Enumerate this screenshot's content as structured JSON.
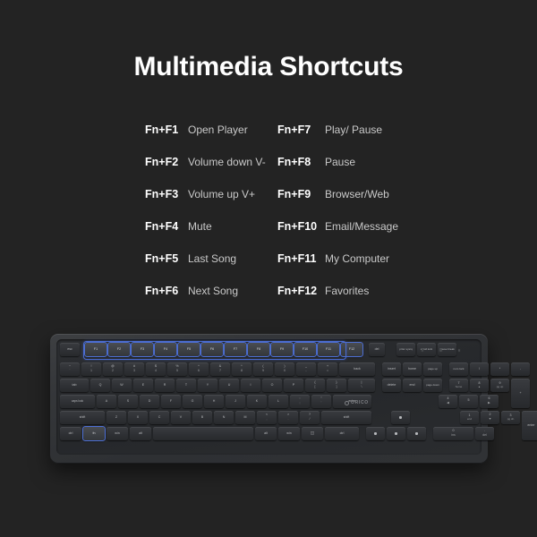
{
  "page": {
    "background_color": "#232323",
    "title": "Multimedia Shortcuts"
  },
  "shortcuts": {
    "rows": [
      {
        "left_combo": "Fn+F1",
        "left_action": "Open Player",
        "right_combo": "Fn+F7",
        "right_action": "Play/ Pause"
      },
      {
        "left_combo": "Fn+F2",
        "left_action": "Volume down V-",
        "right_combo": "Fn+F8",
        "right_action": "Pause"
      },
      {
        "left_combo": "Fn+F3",
        "left_action": "Volume up V+",
        "right_combo": "Fn+F9",
        "right_action": "Browser/Web"
      },
      {
        "left_combo": "Fn+F4",
        "left_action": "Mute",
        "right_combo": "Fn+F10",
        "right_action": "Email/Message"
      },
      {
        "left_combo": "Fn+F5",
        "left_action": "Last Song",
        "right_combo": "Fn+F11",
        "right_action": "My Computer"
      },
      {
        "left_combo": "Fn+F6",
        "left_action": "Next Song",
        "right_combo": "Fn+F12",
        "right_action": "Favorites"
      }
    ]
  },
  "keyboard": {
    "brand": "ORICO",
    "highlight_color": "#4a6bd0",
    "highlighted_keys": [
      "F1",
      "F2",
      "F3",
      "F4",
      "F5",
      "F6",
      "F7",
      "F8",
      "F9",
      "F10",
      "F11",
      "F12",
      "fn"
    ],
    "indicator_leds": 3,
    "rows": {
      "function_row": [
        {
          "label": "esc"
        },
        {
          "label": "F1"
        },
        {
          "label": "F2"
        },
        {
          "label": "F3"
        },
        {
          "label": "F4"
        },
        {
          "label": "F5"
        },
        {
          "label": "F6"
        },
        {
          "label": "F7"
        },
        {
          "label": "F8"
        },
        {
          "label": "F9"
        },
        {
          "label": "F10"
        },
        {
          "label": "F11"
        },
        {
          "label": "F12"
        },
        {
          "label": "del"
        },
        {
          "label": "prtsc sysrq"
        },
        {
          "label": "scroll lock"
        },
        {
          "label": "pause break"
        }
      ],
      "number_row": [
        {
          "top": "~",
          "bot": "`"
        },
        {
          "top": "!",
          "bot": "1"
        },
        {
          "top": "@",
          "bot": "2"
        },
        {
          "top": "#",
          "bot": "3"
        },
        {
          "top": "$",
          "bot": "4"
        },
        {
          "top": "%",
          "bot": "5"
        },
        {
          "top": "^",
          "bot": "6"
        },
        {
          "top": "&",
          "bot": "7"
        },
        {
          "top": "*",
          "bot": "8"
        },
        {
          "top": "(",
          "bot": "9"
        },
        {
          "top": ")",
          "bot": "0"
        },
        {
          "top": "_",
          "bot": "-"
        },
        {
          "top": "+",
          "bot": "="
        },
        {
          "label": "back"
        },
        {
          "label": "insert"
        },
        {
          "label": "home"
        },
        {
          "label": "page up"
        },
        {
          "label": "num lock"
        },
        {
          "label": "/"
        },
        {
          "label": "*"
        },
        {
          "label": "-"
        }
      ],
      "qwerty_row": [
        {
          "label": "tab"
        },
        {
          "label": "Q"
        },
        {
          "label": "W"
        },
        {
          "label": "E"
        },
        {
          "label": "R"
        },
        {
          "label": "T"
        },
        {
          "label": "Y"
        },
        {
          "label": "U"
        },
        {
          "label": "I"
        },
        {
          "label": "O"
        },
        {
          "label": "P"
        },
        {
          "top": "{",
          "bot": "["
        },
        {
          "top": "}",
          "bot": "]"
        },
        {
          "top": "|",
          "bot": "\\"
        },
        {
          "label": "delete"
        },
        {
          "label": "end"
        },
        {
          "label": "page down"
        },
        {
          "top": "7",
          "bot": "home"
        },
        {
          "top": "8",
          "bot": "▲"
        },
        {
          "top": "9",
          "bot": "pg up"
        },
        {
          "label": "+"
        }
      ],
      "home_row": [
        {
          "label": "caps lock"
        },
        {
          "label": "A"
        },
        {
          "label": "S"
        },
        {
          "label": "D"
        },
        {
          "label": "F"
        },
        {
          "label": "G"
        },
        {
          "label": "H"
        },
        {
          "label": "J"
        },
        {
          "label": "K"
        },
        {
          "label": "L"
        },
        {
          "top": ":",
          "bot": ";"
        },
        {
          "top": "\"",
          "bot": "'"
        },
        {
          "label": "enter"
        },
        {
          "top": "4",
          "bot": "◀"
        },
        {
          "top": "5",
          "bot": ""
        },
        {
          "top": "6",
          "bot": "▶"
        }
      ],
      "shift_row": [
        {
          "label": "shift"
        },
        {
          "label": "Z"
        },
        {
          "label": "X"
        },
        {
          "label": "C"
        },
        {
          "label": "V"
        },
        {
          "label": "B"
        },
        {
          "label": "N"
        },
        {
          "label": "M"
        },
        {
          "top": "<",
          "bot": ","
        },
        {
          "top": ">",
          "bot": "."
        },
        {
          "top": "?",
          "bot": "/"
        },
        {
          "label": "shift"
        },
        {
          "label": "▲"
        },
        {
          "top": "1",
          "bot": "end"
        },
        {
          "top": "2",
          "bot": "▼"
        },
        {
          "top": "3",
          "bot": "pg dn"
        },
        {
          "label": "enter"
        }
      ],
      "bottom_row": [
        {
          "label": "ctrl"
        },
        {
          "label": "fn"
        },
        {
          "label": "win"
        },
        {
          "label": "alt"
        },
        {
          "label": ""
        },
        {
          "label": "alt"
        },
        {
          "label": "win"
        },
        {
          "label": "menu"
        },
        {
          "label": "ctrl"
        },
        {
          "label": "◀"
        },
        {
          "label": "▼"
        },
        {
          "label": "▶"
        },
        {
          "top": "0",
          "bot": "ins"
        },
        {
          "top": ".",
          "bot": "del"
        }
      ]
    }
  }
}
